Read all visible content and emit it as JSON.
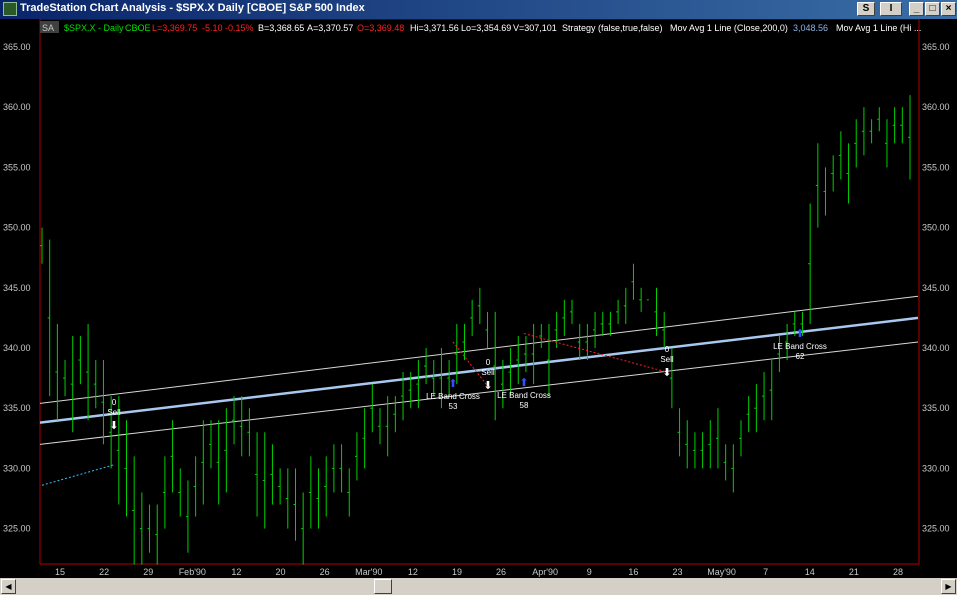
{
  "window": {
    "title": "TradeStation Chart Analysis - $SPX.X Daily [CBOE] S&P 500 Index",
    "buttons": {
      "s_label": "S",
      "i_label": "I",
      "min_label": "_",
      "max_label": "□",
      "close_label": "×"
    }
  },
  "status": {
    "sa": "SA",
    "symbol": "$SPX.X - Daily",
    "exchange": "CBOE",
    "last": "L=3,369.75",
    "change": "-5.10",
    "pct": "-0.15%",
    "bid": "B=3,368.65",
    "ask": "A=3,370.57",
    "open": "O=3,369.48",
    "hi": "Hi=3,371.56",
    "lo": "Lo=3,354.69",
    "vol": "V=307,101",
    "strategy": "Strategy (false,true,false)",
    "mavg": "Mov Avg 1 Line (Close,200,0)",
    "mavg_value": "3,048.56",
    "mavg2": "Mov Avg 1 Line (Hi ..."
  },
  "colors": {
    "bar": "#00d000",
    "ma": "#a8c8f0",
    "band": "#d8d8d8",
    "grid": "#b00000",
    "buy": "#3050ff",
    "sell": "#ffffff",
    "status_red": "#ff2020",
    "status_green": "#00e000",
    "status_white": "#ffffff",
    "status_blue": "#8ab4e8"
  },
  "chart_data": {
    "type": "ohlc-bar",
    "y_ticks": [
      "365.00",
      "360.00",
      "355.00",
      "350.00",
      "345.00",
      "340.00",
      "335.00",
      "330.00",
      "325.00"
    ],
    "ylim": [
      321.5,
      367.5
    ],
    "x_labels": [
      "15",
      "22",
      "29",
      "Feb'90",
      "12",
      "20",
      "26",
      "Mar'90",
      "12",
      "19",
      "26",
      "Apr'90",
      "9",
      "16",
      "23",
      "May'90",
      "7",
      "14",
      "21",
      "28"
    ],
    "bars": [
      [
        350,
        347
      ],
      [
        349,
        336
      ],
      [
        342,
        334
      ],
      [
        339,
        336
      ],
      [
        341,
        333
      ],
      [
        341,
        337
      ],
      [
        342,
        334
      ],
      [
        339,
        335
      ],
      [
        339,
        332
      ],
      [
        336,
        330
      ],
      [
        336,
        327
      ],
      [
        334,
        326
      ],
      [
        331,
        322
      ],
      [
        328,
        322
      ],
      [
        327,
        323
      ],
      [
        327,
        322
      ],
      [
        331,
        325
      ],
      [
        334,
        328
      ],
      [
        330,
        326
      ],
      [
        329,
        323
      ],
      [
        331,
        326
      ],
      [
        334,
        327
      ],
      [
        334,
        330
      ],
      [
        334,
        327
      ],
      [
        335,
        328
      ],
      [
        336,
        332
      ],
      [
        336,
        331
      ],
      [
        335,
        331
      ],
      [
        333,
        326
      ],
      [
        333,
        325
      ],
      [
        332,
        327
      ],
      [
        330,
        327
      ],
      [
        330,
        325
      ],
      [
        330,
        324
      ],
      [
        328,
        322
      ],
      [
        331,
        325
      ],
      [
        330,
        325
      ],
      [
        331,
        326
      ],
      [
        332,
        328
      ],
      [
        332,
        328
      ],
      [
        330,
        326
      ],
      [
        333,
        329
      ],
      [
        335,
        330
      ],
      [
        337,
        333
      ],
      [
        335,
        332
      ],
      [
        336,
        331
      ],
      [
        336,
        333
      ],
      [
        338,
        334
      ],
      [
        338,
        335
      ],
      [
        339,
        335
      ],
      [
        340,
        337
      ],
      [
        339,
        336
      ],
      [
        340,
        335
      ],
      [
        339,
        336
      ],
      [
        342,
        337
      ],
      [
        342,
        339
      ],
      [
        344,
        341
      ],
      [
        345,
        342
      ],
      [
        343,
        340
      ],
      [
        343,
        334
      ],
      [
        339,
        335
      ],
      [
        340,
        336
      ],
      [
        341,
        337
      ],
      [
        341,
        338
      ],
      [
        342,
        337
      ],
      [
        342,
        340
      ],
      [
        342,
        336
      ],
      [
        343,
        340
      ],
      [
        344,
        341
      ],
      [
        344,
        342
      ],
      [
        342,
        339
      ],
      [
        342,
        339
      ],
      [
        343,
        340
      ],
      [
        343,
        341
      ],
      [
        343,
        341
      ],
      [
        344,
        342
      ],
      [
        345,
        342
      ],
      [
        347,
        344
      ],
      [
        345,
        343
      ],
      [
        344,
        344
      ],
      [
        345,
        341
      ],
      [
        343,
        340
      ],
      [
        340,
        335
      ],
      [
        335,
        331
      ],
      [
        334,
        330
      ],
      [
        333,
        330
      ],
      [
        333,
        330
      ],
      [
        334,
        330
      ],
      [
        335,
        330
      ],
      [
        332,
        329
      ],
      [
        332,
        328
      ],
      [
        334,
        331
      ],
      [
        336,
        333
      ],
      [
        337,
        333
      ],
      [
        338,
        334
      ],
      [
        339,
        334
      ],
      [
        341,
        338
      ],
      [
        342,
        339
      ],
      [
        343,
        341
      ],
      [
        343,
        341
      ],
      [
        352,
        342
      ],
      [
        357,
        350
      ],
      [
        355,
        351
      ],
      [
        356,
        353
      ],
      [
        358,
        354
      ],
      [
        357,
        352
      ],
      [
        359,
        355
      ],
      [
        360,
        356
      ],
      [
        359,
        357
      ],
      [
        360,
        358
      ],
      [
        359,
        355
      ],
      [
        360,
        357
      ],
      [
        360,
        357
      ],
      [
        361,
        354
      ]
    ],
    "moving_average": {
      "start": 333.8,
      "end": 342.5
    },
    "band_upper": {
      "start": 335.4,
      "end": 344.3
    },
    "band_lower": {
      "start": 332.0,
      "end": 340.5
    },
    "signals": [
      {
        "type": "sell",
        "count": "0",
        "label": "Sell",
        "date": "22"
      },
      {
        "type": "buy",
        "count": "53",
        "label": "LE Band Cross",
        "date": "19"
      },
      {
        "type": "sell",
        "count": "0",
        "label": "Sell",
        "date": "26"
      },
      {
        "type": "buy",
        "count": "58",
        "label": "LE Band Cross",
        "date": "Apr'90"
      },
      {
        "type": "sell",
        "count": "0",
        "label": "Sell",
        "date": "23"
      },
      {
        "type": "buy",
        "count": "62",
        "label": "LE Band Cross",
        "date": "14"
      }
    ]
  }
}
